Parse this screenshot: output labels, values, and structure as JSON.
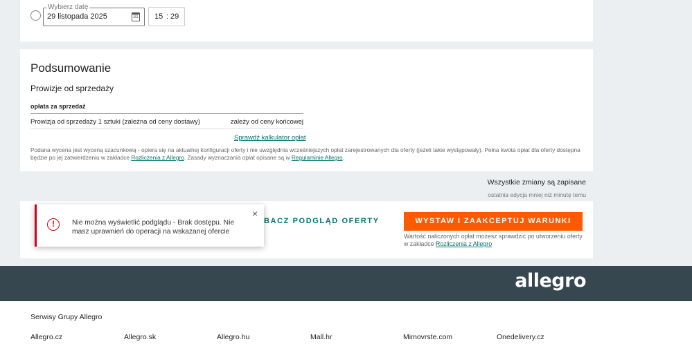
{
  "schedule": {
    "date_legend": "Wybierz datę",
    "date_value": "29 listopada 2025",
    "calendar_icon_label": "31",
    "hour": "15",
    "separator": ":",
    "minute": "29"
  },
  "summary": {
    "title": "Podsumowanie",
    "fees_title": "Prowizje od sprzedaży",
    "table_header": "opłata za sprzedaż",
    "row_label": "Prowizja od sprzedaży 1 sztuki (zależna od ceny dostawy)",
    "row_value": "zależy od ceny końcowej",
    "calculator_link": "Sprawdź kalkulator opłat",
    "disclaimer_part1": "Podana wycena jest wyceną szacunkową - opiera się na aktualnej konfiguracji oferty i nie uwzględnia wcześniejszych opłat zarejestrowanych dla oferty (jeżeli takie występowały). Pełna kwota opłat dla oferty dostępna będzie po jej zatwierdzeniu w zakładce ",
    "disclaimer_link1": "Rozliczenia z Allegro",
    "disclaimer_part2": ". Zasady wyznaczania opłat opisane są w ",
    "disclaimer_link2": "Regulaminie Allegro",
    "disclaimer_part3": "."
  },
  "save_status": {
    "main": "Wszystkie zmiany są zapisane",
    "sub": "ostatnia edycja mniej niż minutę temu"
  },
  "actions": {
    "preview_label": "BACZ PODGLĄD OFERTY",
    "submit_label": "WYSTAW I ZAAKCEPTUJ WARUNKI",
    "note_text": "Wartość naliczonych opłat możesz sprawdzić po utworzeniu oferty w zakładce ",
    "note_link": "Rozliczenia z Allegro"
  },
  "toast": {
    "icon": "!",
    "message": "Nie można wyświetlić podglądu - Brak dostępu. Nie masz uprawnień do operacji na wskazanej ofercie",
    "close": "×"
  },
  "footer": {
    "logo": "allegro",
    "services_title": "Serwisy Grupy Allegro",
    "services": [
      "Allegro.cz",
      "Allegro.sk",
      "Allegro.hu",
      "Mall.hr",
      "Mimovrste.com",
      "Onedelivery.cz"
    ]
  },
  "colors": {
    "accent": "#ff5a00",
    "link": "#00736b",
    "error": "#d0021b",
    "footer_bg": "#36474f"
  }
}
